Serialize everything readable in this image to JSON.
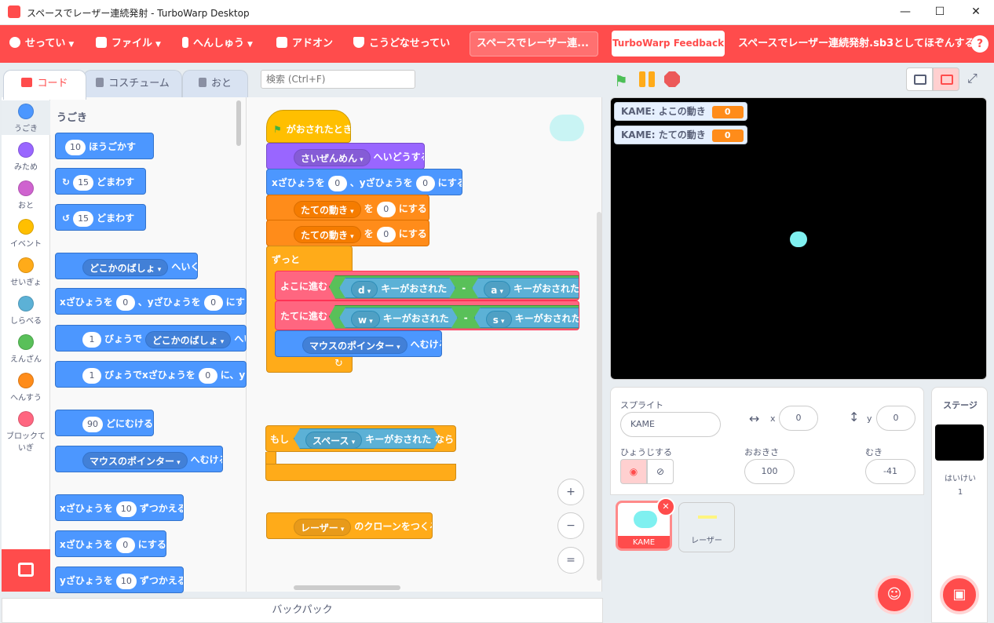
{
  "window": {
    "title": "スペースでレーザー連続発射 - TurboWarp Desktop",
    "minimize": "—",
    "maximize": "☐",
    "close": "✕"
  },
  "menu": {
    "settings": "せってい",
    "file": "ファイル",
    "edit": "へんしゅう",
    "addons": "アドオン",
    "advanced": "こうどなせってい",
    "project_title": "スペースでレーザー連...",
    "feedback": "TurboWarp Feedback",
    "save_as": "スペースでレーザー連続発射.sb3としてほぞんする",
    "help": "?"
  },
  "tabs": {
    "code": "コード",
    "costumes": "コスチューム",
    "sounds": "おと"
  },
  "search": {
    "placeholder": "検索 (Ctrl+F)"
  },
  "categories": [
    {
      "label": "うごき",
      "color": "#4c97ff"
    },
    {
      "label": "みため",
      "color": "#9966ff"
    },
    {
      "label": "おと",
      "color": "#cf63cf"
    },
    {
      "label": "イベント",
      "color": "#ffbf00"
    },
    {
      "label": "せいぎょ",
      "color": "#ffab19"
    },
    {
      "label": "しらべる",
      "color": "#5cb1d6"
    },
    {
      "label": "えんざん",
      "color": "#59c059"
    },
    {
      "label": "へんすう",
      "color": "#ff8c1a"
    },
    {
      "label": "ブロックて",
      "label2": "いぎ",
      "color": "#ff6680"
    }
  ],
  "palette": {
    "heading": "うごき",
    "move_steps": "10",
    "move_label": "ほうごかす",
    "turn_r_deg": "15",
    "turn_label": "どまわす",
    "turn_l_deg": "15",
    "goto_target": "どこかのばしょ",
    "goto_label": "へいく",
    "gotoxy_x_label": "xざひょうを",
    "gotoxy_x": "0",
    "gotoxy_y_label": "、yざひょうを",
    "gotoxy_y": "0",
    "gotoxy_end": "にする",
    "glide_secs": "1",
    "glide_label": "びょうで",
    "glide_target": "どこかのばしょ",
    "glide_end": "へい",
    "glidexy_secs": "1",
    "glidexy_label": "びょうでxざひょうを",
    "glidexy_x": "0",
    "glidexy_end": "に、yざ",
    "point_deg": "90",
    "point_label": "どにむける",
    "pointto_target": "マウスのポインター",
    "pointto_label": "へむける",
    "changex_label": "xざひょうを",
    "changex_val": "10",
    "changex_end": "ずつかえる",
    "setx_label": "xざひょうを",
    "setx_val": "0",
    "setx_end": "にする",
    "changey_label": "yざひょうを",
    "changey_val": "10",
    "changey_end": "ずつかえる"
  },
  "script": {
    "hat_label": "がおされたとき",
    "backdrop_target": "さいぜんめん",
    "backdrop_label": "へいどうする",
    "gotoxy_x_label": "xざひょうを",
    "gotoxy_x": "0",
    "gotoxy_y_label": "、yざひょうを",
    "gotoxy_y": "0",
    "gotoxy_end": "にする",
    "set1_var": "たての動き",
    "set1_mid": "を",
    "set1_val": "0",
    "set1_end": "にする",
    "set2_var": "たての動き",
    "set2_mid": "を",
    "set2_val": "0",
    "set2_end": "にする",
    "forever": "ずっと",
    "yoko_label": "よこに進む",
    "yoko_key1": "d",
    "key_pressed": "キーがおされた",
    "minus": "-",
    "yoko_key2": "a",
    "tate_label": "たてに進む",
    "tate_key1": "w",
    "tate_key2": "s",
    "pointto_target": "マウスのポインター",
    "pointto_label": "へむける",
    "loop_arrow": "↻",
    "if_label": "もし",
    "if_key": "スペース",
    "if_pressed": "キーがおされた",
    "if_then": "なら",
    "clone_target": "レーザー",
    "clone_label": "のクローンをつくる"
  },
  "zoom": {
    "in": "+",
    "out": "−",
    "reset": "="
  },
  "backpack": "バックパック",
  "stage": {
    "monitor1_label": "KAME: よこの動き",
    "monitor1_value": "0",
    "monitor2_label": "KAME: たての動き",
    "monitor2_value": "0"
  },
  "sprite_info": {
    "sprite_label": "スプライト",
    "sprite_name": "KAME",
    "x_label": "x",
    "x": "0",
    "y_label": "y",
    "y": "0",
    "show_label": "ひょうじする",
    "size_label": "おおきさ",
    "size": "100",
    "dir_label": "むき",
    "direction": "-41"
  },
  "sprites": [
    {
      "name": "KAME"
    },
    {
      "name": "レーザー"
    }
  ],
  "stage_pane": {
    "title": "ステージ",
    "backdrops_label": "はいけい",
    "backdrops_count": "1"
  },
  "colors": {
    "brand": "#ff4c4c",
    "motion": "#4c97ff",
    "events": "#ffbf00",
    "control": "#ffab19",
    "variables": "#ff8c1a",
    "myblocks": "#ff6680",
    "sensing": "#5cb1d6",
    "operators": "#59c059",
    "looks": "#9966ff"
  }
}
